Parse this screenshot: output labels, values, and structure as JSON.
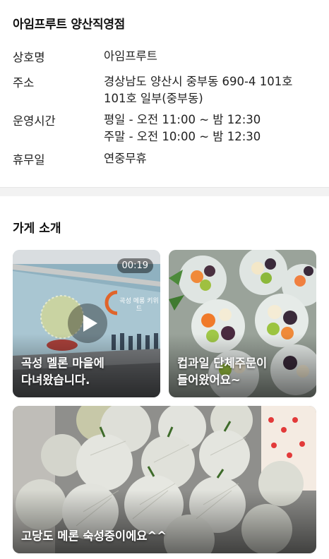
{
  "store": {
    "title": "아임프루트 양산직영점"
  },
  "info": {
    "name_label": "상호명",
    "name_value": "아임프루트",
    "address_label": "주소",
    "address_line1": "경상남도 양산시 중부동 690-4 101호",
    "address_line2": "101호 일부(중부동)",
    "hours_label": "운영시간",
    "hours_weekday": "평일 - 오전 11:00 ~ 밤 12:30",
    "hours_weekend": "주말 - 오전 10:00 ~ 밤 12:30",
    "closed_label": "휴무일",
    "closed_value": "연중무휴"
  },
  "intro": {
    "title": "가게 소개",
    "cards": [
      {
        "caption_line1": "곡성 멜론 마을에",
        "caption_line2": "다녀왔습니다.",
        "duration": "00:19",
        "mural_text": "곡성 메롱 키위드"
      },
      {
        "caption_line1": "컵과일 단체주문이",
        "caption_line2": "들어왔어요~"
      },
      {
        "caption_line1": "고당도 메론 숙성중이에요^^"
      }
    ]
  }
}
